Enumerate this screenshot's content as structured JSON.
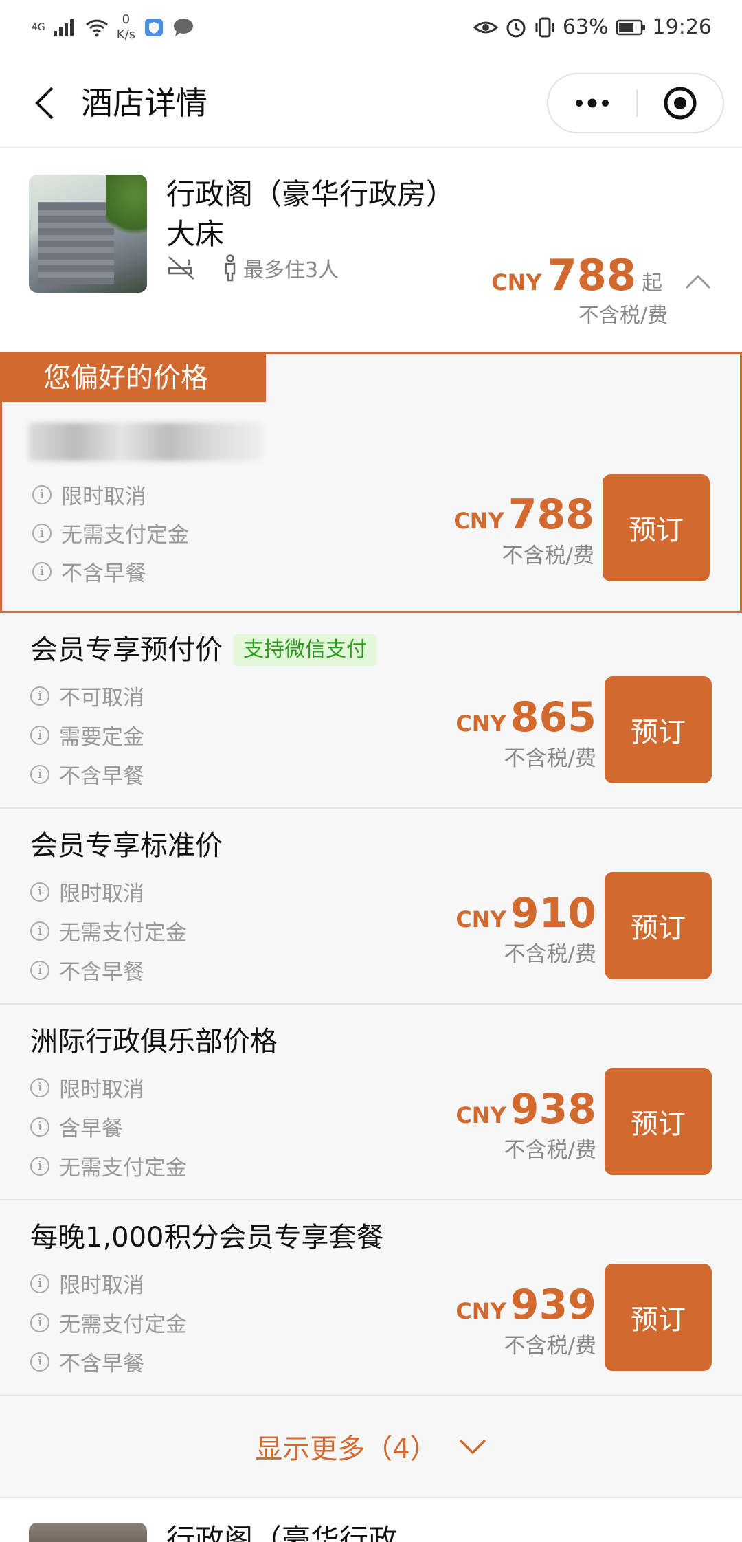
{
  "status_bar": {
    "network": "4G",
    "speed_value": "0",
    "speed_unit": "K/s",
    "battery": "63%",
    "time": "19:26"
  },
  "header": {
    "title": "酒店详情"
  },
  "room": {
    "name": "行政阁（豪华行政房）大床",
    "occupancy": "最多住3人",
    "currency": "CNY",
    "price": "788",
    "from_suffix": "起",
    "tax_note": "不含税/费"
  },
  "preferred_tag": "您偏好的价格",
  "rates": [
    {
      "title": "",
      "blurred": true,
      "features": [
        "限时取消",
        "无需支付定金",
        "不含早餐"
      ],
      "currency": "CNY",
      "price": "788",
      "tax_note": "不含税/费",
      "book_label": "预订"
    },
    {
      "title": "会员专享预付价",
      "tag": "支持微信支付",
      "features": [
        "不可取消",
        "需要定金",
        "不含早餐"
      ],
      "currency": "CNY",
      "price": "865",
      "tax_note": "不含税/费",
      "book_label": "预订"
    },
    {
      "title": "会员专享标准价",
      "features": [
        "限时取消",
        "无需支付定金",
        "不含早餐"
      ],
      "currency": "CNY",
      "price": "910",
      "tax_note": "不含税/费",
      "book_label": "预订"
    },
    {
      "title": "洲际行政俱乐部价格",
      "features": [
        "限时取消",
        "含早餐",
        "无需支付定金"
      ],
      "currency": "CNY",
      "price": "938",
      "tax_note": "不含税/费",
      "book_label": "预订"
    },
    {
      "title": "每晚1,000积分会员专享套餐",
      "features": [
        "限时取消",
        "无需支付定金",
        "不含早餐"
      ],
      "currency": "CNY",
      "price": "939",
      "tax_note": "不含税/费",
      "book_label": "预订"
    }
  ],
  "show_more": "显示更多（4）",
  "next_room": {
    "name": "行政阁（豪华行政"
  },
  "colors": {
    "accent": "#d2692f",
    "wechat_tag_bg": "#e3f8d8",
    "wechat_tag_text": "#2f9a20"
  },
  "icons": {
    "back": "chevron-left-icon",
    "more": "more-dots-icon",
    "target": "target-icon",
    "no_smoking": "no-smoking-icon",
    "person": "person-icon",
    "collapse": "chevron-up-icon",
    "info": "info-icon",
    "expand": "chevron-down-icon"
  }
}
